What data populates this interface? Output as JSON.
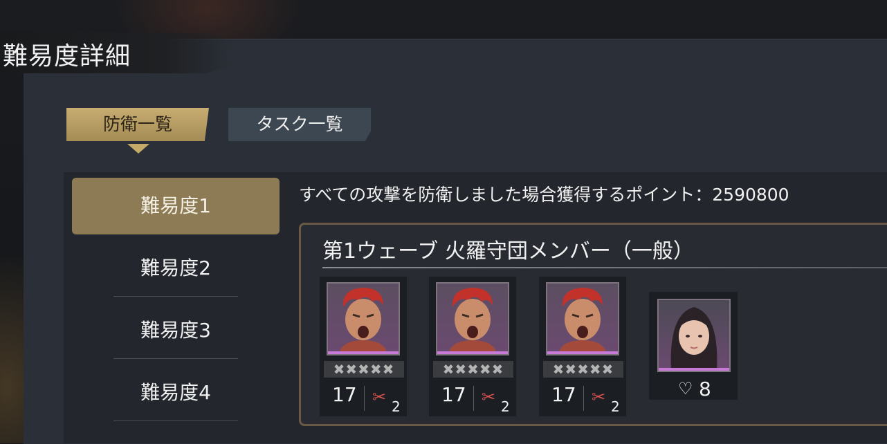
{
  "header": {
    "title": "難易度詳細"
  },
  "tabs": [
    {
      "label": "防衛一覧",
      "active": true
    },
    {
      "label": "タスク一覧",
      "active": false
    }
  ],
  "difficulties": [
    {
      "label": "難易度1",
      "active": true
    },
    {
      "label": "難易度2",
      "active": false
    },
    {
      "label": "難易度3",
      "active": false
    },
    {
      "label": "難易度4",
      "active": false
    }
  ],
  "points_text": "すべての攻撃を防衛しました場合獲得するポイント：2590800",
  "wave": {
    "title": "第1ウェーブ  火羅守団メンバー（一般）",
    "enemies": [
      {
        "stars": "✖✖✖✖✖",
        "level": "17",
        "skill_count": "2",
        "icon": "red-hair-man-portrait"
      },
      {
        "stars": "✖✖✖✖✖",
        "level": "17",
        "skill_count": "2",
        "icon": "red-hair-man-portrait"
      },
      {
        "stars": "✖✖✖✖✖",
        "level": "17",
        "skill_count": "2",
        "icon": "red-hair-man-portrait"
      }
    ],
    "ally": {
      "heart_count": "8",
      "icon": "dark-hair-woman-portrait"
    }
  },
  "colors": {
    "accent_gold": "#c5a968",
    "panel": "#2b3038",
    "active_item": "#8c7b54"
  }
}
